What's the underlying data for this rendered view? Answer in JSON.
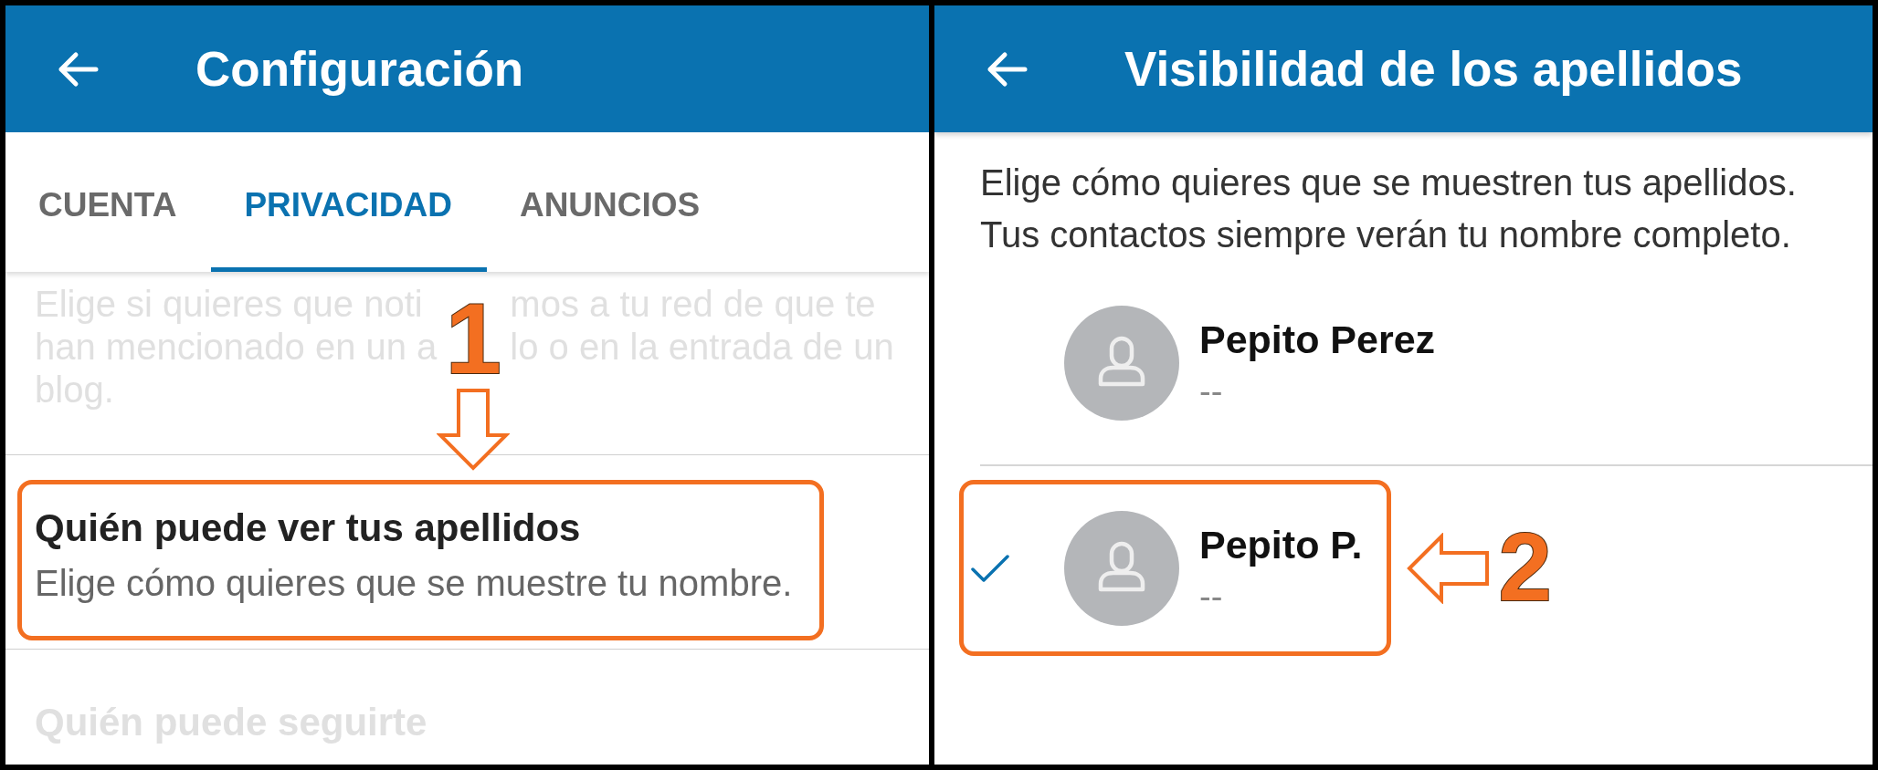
{
  "left_screen": {
    "header": {
      "title": "Configuración"
    },
    "tabs": [
      {
        "label": "CUENTA",
        "selected": false
      },
      {
        "label": "PRIVACIDAD",
        "selected": true
      },
      {
        "label": "ANUNCIOS",
        "selected": false
      }
    ],
    "settings": [
      {
        "dimmed": true,
        "highlighted": false,
        "description_lines": [
          [
            "Elige si quieres que noti",
            "mos a tu red de que te"
          ],
          [
            "han mencionado en un a",
            "lo o en la entrada de un"
          ],
          [
            "blog."
          ]
        ],
        "callout": {
          "label": "1"
        }
      },
      {
        "dimmed": false,
        "highlighted": true,
        "title": "Quién puede ver tus apellidos",
        "description_lines": [
          [
            "Elige cómo quieres que se muestre tu nombre."
          ]
        ]
      },
      {
        "dimmed": true,
        "highlighted": false,
        "title": "Quién puede seguirte"
      }
    ]
  },
  "right_screen": {
    "header": {
      "title": "Visibilidad de los apellidos"
    },
    "description": "Elige cómo quieres que se muestren tus apellidos.\nTus contactos siempre verán tu nombre completo.",
    "options": [
      {
        "name": "Pepito Perez",
        "detail": "--",
        "selected": false,
        "highlighted": false
      },
      {
        "name": "Pepito P.",
        "detail": "--",
        "selected": true,
        "highlighted": true,
        "callout": {
          "label": "2"
        }
      }
    ]
  }
}
